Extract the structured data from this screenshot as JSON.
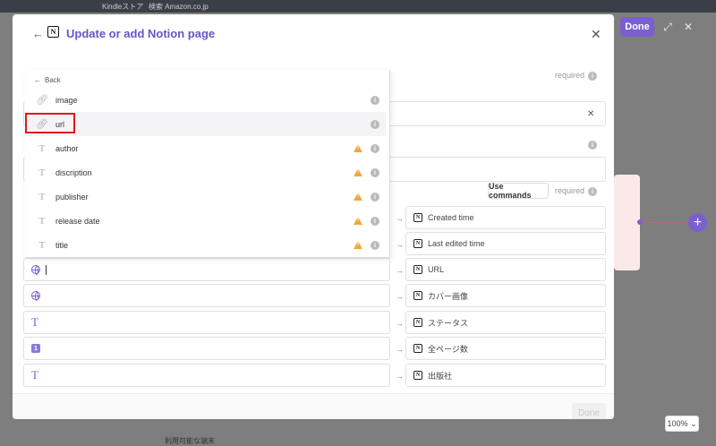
{
  "background": {
    "tabs": [
      "Kindleストア",
      "検索 Amazon.co.jp"
    ],
    "zoom": "100%",
    "bottom_note": "利用可能な端末"
  },
  "toolbar": {
    "done_label": "Done"
  },
  "modal": {
    "title": "Update or add Notion page",
    "required_label": "required",
    "use_commands_label": "Use commands",
    "footer_done_label": "Done"
  },
  "dropdown": {
    "back_label": "Back",
    "items": [
      {
        "label": "image",
        "icon": "link-icon",
        "warning": false
      },
      {
        "label": "url",
        "icon": "link-icon",
        "warning": false,
        "selected": true
      },
      {
        "label": "author",
        "icon": "text-icon",
        "warning": true
      },
      {
        "label": "discription",
        "icon": "text-icon",
        "warning": true
      },
      {
        "label": "publisher",
        "icon": "text-icon",
        "warning": true
      },
      {
        "label": "release date",
        "icon": "text-icon",
        "warning": true
      },
      {
        "label": "title",
        "icon": "text-icon",
        "warning": true
      }
    ]
  },
  "mappings": [
    {
      "left_icon": "",
      "right": "Created time"
    },
    {
      "left_icon": "",
      "right": "Last edited time"
    },
    {
      "left_icon": "globe-icon",
      "right": "URL"
    },
    {
      "left_icon": "globe-icon",
      "right": "カバー画像"
    },
    {
      "left_icon": "text-icon",
      "right": "ステータス"
    },
    {
      "left_icon": "number-icon",
      "right": "全ページ数"
    },
    {
      "left_icon": "text-icon",
      "right": "出版社"
    }
  ],
  "colors": {
    "accent": "#7b5fd1",
    "highlight": "#e01b1b",
    "warning": "#f0a83a"
  }
}
